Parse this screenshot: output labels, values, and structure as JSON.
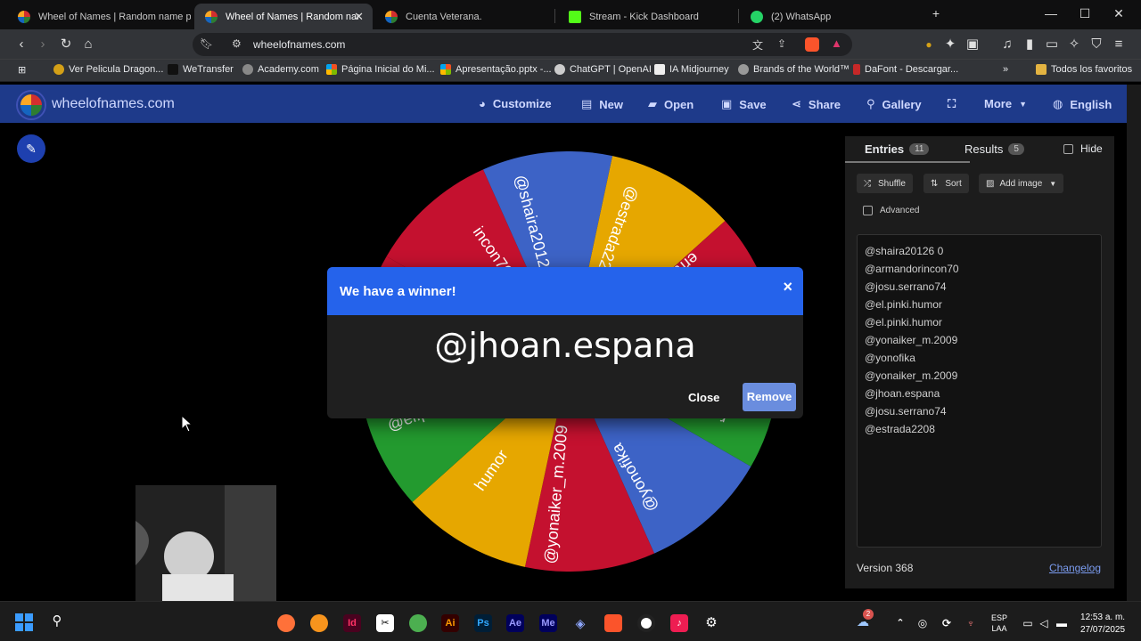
{
  "browser": {
    "tabs": [
      {
        "title": "Wheel of Names | Random name pick",
        "active": false
      },
      {
        "title": "Wheel of Names | Random name pick",
        "active": true
      },
      {
        "title": "Cuenta Veterana.",
        "active": false
      },
      {
        "title": "Stream - Kick Dashboard",
        "active": false
      },
      {
        "title": "(2) WhatsApp",
        "active": false
      }
    ],
    "url": "wheelofnames.com",
    "bookmarks": [
      "Ver Pelicula Dragon...",
      "WeTransfer",
      "Academy.com",
      "Página Inicial do Mi...",
      "Apresentação.pptx -...",
      "ChatGPT | OpenAI",
      "IA Midjourney",
      "Brands of the World™",
      "DaFont - Descargar...",
      "Todos los favoritos"
    ],
    "overflow": "»"
  },
  "site": {
    "name": "wheelofnames.com",
    "nav": {
      "customize": "Customize",
      "new": "New",
      "open": "Open",
      "save": "Save",
      "share": "Share",
      "gallery": "Gallery",
      "more": "More",
      "language": "English"
    }
  },
  "sidebar": {
    "entries_tab": "Entries",
    "entries_count": "11",
    "results_tab": "Results",
    "results_count": "5",
    "hide": "Hide",
    "shuffle": "Shuffle",
    "sort": "Sort",
    "add_image": "Add image",
    "advanced": "Advanced",
    "entries": [
      "@shaira20126 0",
      "@armandorincon70",
      "@josu.serrano74",
      "@el.pinki.humor",
      "@el.pinki.humor",
      "@yonaiker_m.2009",
      "@yonofika",
      "@yonaiker_m.2009",
      "@jhoan.espana",
      "@josu.serrano74",
      "@estrada2208"
    ],
    "version": "Version 368",
    "changelog": "Changelog"
  },
  "wheel": {
    "visible_labels": [
      "@shaira20126 0",
      "@estrada2208",
      "errano74",
      "incon70",
      "@el.pinki.humor",
      "@yonaiker_m.2009",
      "@yonofika",
      "r_m.2009",
      "humor"
    ],
    "colors": [
      "#c4112f",
      "#3d63c6",
      "#e6a700",
      "#c4112f",
      "#239a2f",
      "#3d63c6",
      "#c4112f",
      "#e6a700",
      "#239a2f",
      "#c4112f"
    ]
  },
  "modal": {
    "title": "We have a winner!",
    "winner": "@jhoan.espana",
    "close": "Close",
    "remove": "Remove"
  },
  "taskbar": {
    "lang_line1": "ESP",
    "lang_line2": "LAA",
    "time": "12:53 a. m.",
    "date": "27/07/2025",
    "notification_count": "2"
  }
}
